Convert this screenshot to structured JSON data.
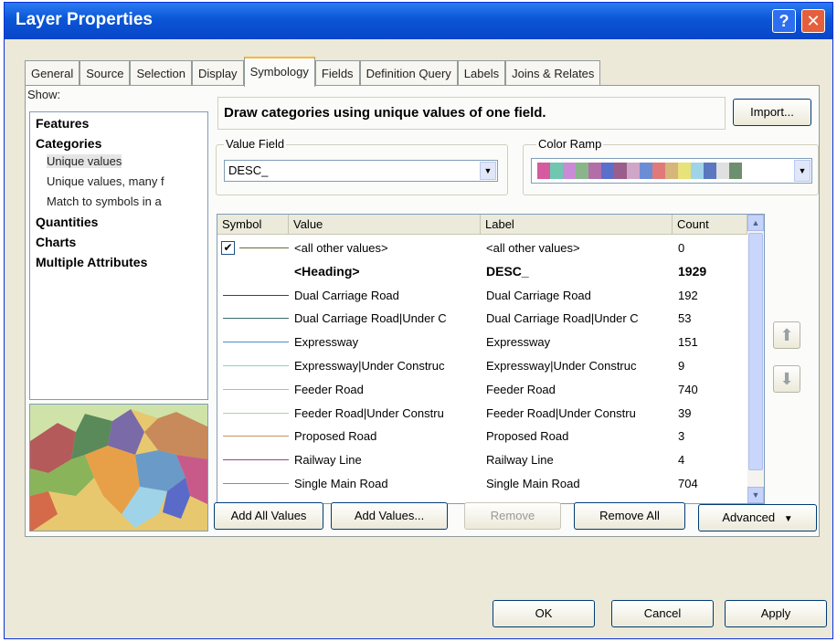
{
  "window": {
    "title": "Layer Properties",
    "help_label": "?",
    "close_label": "✕"
  },
  "tabs": [
    {
      "label": "General"
    },
    {
      "label": "Source"
    },
    {
      "label": "Selection"
    },
    {
      "label": "Display"
    },
    {
      "label": "Symbology",
      "active": true
    },
    {
      "label": "Fields"
    },
    {
      "label": "Definition Query"
    },
    {
      "label": "Labels"
    },
    {
      "label": "Joins & Relates"
    }
  ],
  "show": {
    "label": "Show:",
    "items": [
      {
        "label": "Features",
        "style": "bold"
      },
      {
        "label": "Categories",
        "style": "bold"
      },
      {
        "label": "Unique values",
        "style": "sub",
        "selected": true
      },
      {
        "label": "Unique values, many f",
        "style": "sub"
      },
      {
        "label": "Match to symbols in a",
        "style": "sub"
      },
      {
        "label": "Quantities",
        "style": "bold"
      },
      {
        "label": "Charts",
        "style": "bold"
      },
      {
        "label": "Multiple Attributes",
        "style": "bold"
      }
    ]
  },
  "description": "Draw categories using unique values of one field.",
  "import_label": "Import...",
  "value_field": {
    "label": "Value Field",
    "value": "DESC_"
  },
  "color_ramp": {
    "label": "Color Ramp",
    "colors": [
      "#d65aa0",
      "#6fc7b0",
      "#c98bd6",
      "#8ab48c",
      "#b26ea8",
      "#5b6ec9",
      "#9b5e8c",
      "#d0a6c8",
      "#6c8dd6",
      "#e07a7a",
      "#d6b67a",
      "#e8e27a",
      "#9fd4e8",
      "#5a77c0",
      "#e0e0e0",
      "#6e8f6e"
    ]
  },
  "table": {
    "headers": {
      "symbol": "Symbol",
      "value": "Value",
      "label": "Label",
      "count": "Count"
    },
    "rows": [
      {
        "value": "<all other values>",
        "label": "<all other values>",
        "count": "0",
        "color": "#6b6b3a",
        "checked": true
      },
      {
        "value": "<Heading>",
        "label": "DESC_",
        "count": "1929",
        "heading": true
      },
      {
        "value": "Dual Carriage Road",
        "label": "Dual Carriage Road",
        "count": "192",
        "color": "#3a3a7a"
      },
      {
        "value": "Dual Carriage Road|Under C",
        "label": "Dual Carriage Road|Under C",
        "count": "53",
        "color": "#3a6a6a"
      },
      {
        "value": "Expressway",
        "label": "Expressway",
        "count": "151",
        "color": "#4a90c8"
      },
      {
        "value": "Expressway|Under Construc",
        "label": "Expressway|Under Construc",
        "count": "9",
        "color": "#7fd4d0"
      },
      {
        "value": "Feeder Road",
        "label": "Feeder Road",
        "count": "740",
        "color": "#d4a0c8"
      },
      {
        "value": "Feeder Road|Under Constru",
        "label": "Feeder Road|Under Constru",
        "count": "39",
        "color": "#a8d8a0"
      },
      {
        "value": "Proposed Road",
        "label": "Proposed Road",
        "count": "3",
        "color": "#c89060"
      },
      {
        "value": "Railway Line",
        "label": "Railway Line",
        "count": "4",
        "color": "#8a4a8a"
      },
      {
        "value": "Single Main Road",
        "label": "Single Main Road",
        "count": "704",
        "color": "#d07070"
      }
    ]
  },
  "buttons": {
    "add_all": "Add All Values",
    "add_values": "Add Values...",
    "remove": "Remove",
    "remove_all": "Remove All",
    "advanced": "Advanced",
    "ok": "OK",
    "cancel": "Cancel",
    "apply": "Apply"
  }
}
